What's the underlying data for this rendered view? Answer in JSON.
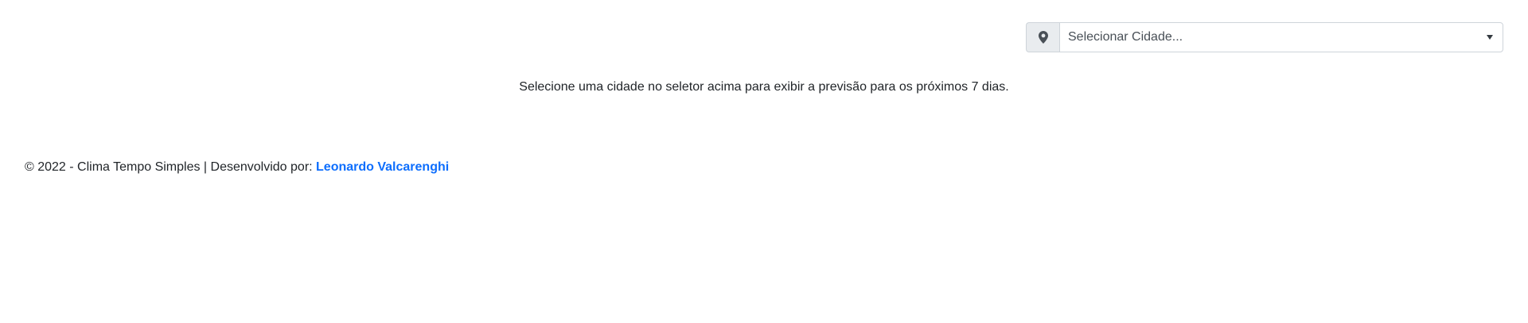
{
  "city_selector": {
    "placeholder": "Selecionar Cidade...",
    "addon_icon": "map-marker-icon",
    "dropdown_icon": "caret-down-icon"
  },
  "info_message": "Selecione uma cidade no seletor acima para exibir a previsão para os próximos 7 dias.",
  "footer": {
    "text": "© 2022 - Clima Tempo Simples | Desenvolvido por: ",
    "author_link": "Leonardo Valcarenghi"
  },
  "colors": {
    "link": "#0d6efd",
    "addon_background": "#e9ecef",
    "border": "#ced4da",
    "text": "#212529"
  }
}
